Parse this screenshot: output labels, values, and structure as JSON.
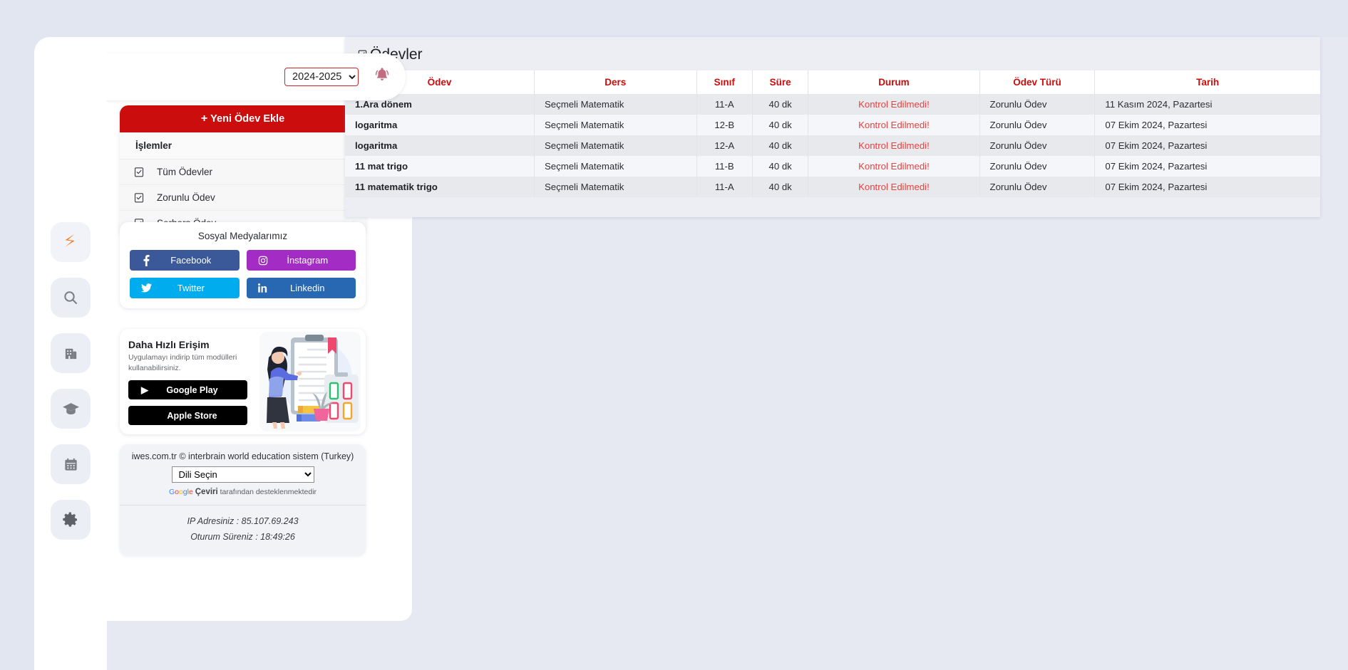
{
  "header": {
    "year_selected": "2024-2025",
    "year_options": [
      "2024-2025"
    ],
    "bell_icon": "bell-icon"
  },
  "icon_rail": [
    {
      "name": "logo-icon",
      "label": "iWES"
    },
    {
      "name": "search-icon",
      "label": "Arama"
    },
    {
      "name": "building-icon",
      "label": "Kurum"
    },
    {
      "name": "graduation-cap-icon",
      "label": "Okul"
    },
    {
      "name": "calendar-icon",
      "label": "Takvim"
    },
    {
      "name": "gear-icon",
      "label": "Ayarlar"
    }
  ],
  "menu": {
    "new_button_label": "Yeni Ödev Ekle",
    "new_button_plus": "+",
    "section_title": "İşlemler",
    "items": [
      {
        "label": "Tüm Ödevler",
        "icon": "clipboard-check-icon",
        "chevron": "›"
      },
      {
        "label": "Zorunlu Ödev",
        "icon": "clipboard-check-icon",
        "chevron": "›"
      },
      {
        "label": "Serbers Ödev",
        "icon": "clipboard-check-icon",
        "chevron": "›"
      }
    ]
  },
  "social": {
    "title": "Sosyal Medyalarımız",
    "buttons": [
      {
        "label": "Facebook",
        "icon": "facebook-icon",
        "glyph": "f",
        "color": "#3b5998"
      },
      {
        "label": "İnstagram",
        "icon": "instagram-icon",
        "glyph": "◙",
        "color": "#a32cc4"
      },
      {
        "label": "Twitter",
        "icon": "twitter-icon",
        "glyph": "🐦",
        "color": "#00acee"
      },
      {
        "label": "Linkedin",
        "icon": "linkedin-icon",
        "glyph": "in",
        "color": "#2867b2"
      }
    ]
  },
  "promo": {
    "title": "Daha Hızlı Erişim",
    "subtitle": "Uygulamayı indirip tüm modülleri kullanabilirsiniz.",
    "google_play_label": "Google Play",
    "apple_store_label": "Apple Store",
    "google_play_icon": "play-triangle-icon",
    "apple_store_icon": "apple-icon",
    "illustration": "woman-with-clipboard-illustration"
  },
  "footer": {
    "copyright": "iwes.com.tr © interbrain world education sistem (Turkey)",
    "language_selected": "Dili Seçin",
    "language_options": [
      "Dili Seçin"
    ],
    "google_translate_prefix": "Google",
    "google_translate_strong": "Çeviri",
    "google_translate_suffix": " tarafından desteklenmektedir",
    "ip_line": "IP Adresiniz : 85.107.69.243",
    "session_line": "Oturum Süreniz : 18:49:26"
  },
  "content": {
    "title": "Ödevler",
    "title_icon": "clipboard-check-icon",
    "columns": [
      "Ödev",
      "Ders",
      "Sınıf",
      "Süre",
      "Durum",
      "Ödev Türü",
      "Tarih"
    ],
    "rows": [
      {
        "odev": "1.Ara dönem",
        "ders": "Seçmeli Matematik",
        "sinif": "11-A",
        "sure": "40 dk",
        "durum": "Kontrol Edilmedi!",
        "tur": "Zorunlu Ödev",
        "tarih": "11 Kasım 2024, Pazartesi"
      },
      {
        "odev": "logaritma",
        "ders": "Seçmeli Matematik",
        "sinif": "12-B",
        "sure": "40 dk",
        "durum": "Kontrol Edilmedi!",
        "tur": "Zorunlu Ödev",
        "tarih": "07 Ekim 2024, Pazartesi"
      },
      {
        "odev": "logaritma",
        "ders": "Seçmeli Matematik",
        "sinif": "12-A",
        "sure": "40 dk",
        "durum": "Kontrol Edilmedi!",
        "tur": "Zorunlu Ödev",
        "tarih": "07 Ekim 2024, Pazartesi"
      },
      {
        "odev": "11 mat trigo",
        "ders": "Seçmeli Matematik",
        "sinif": "11-B",
        "sure": "40 dk",
        "durum": "Kontrol Edilmedi!",
        "tur": "Zorunlu Ödev",
        "tarih": "07 Ekim 2024, Pazartesi"
      },
      {
        "odev": "11 matematik trigo",
        "ders": "Seçmeli Matematik",
        "sinif": "11-A",
        "sure": "40 dk",
        "durum": "Kontrol Edilmedi!",
        "tur": "Zorunlu Ödev",
        "tarih": "07 Ekim 2024, Pazartesi"
      }
    ]
  },
  "colors": {
    "brand_red": "#cc0d0d",
    "status_red": "#e8413f",
    "logo_orange": "#f47b20",
    "page_bg": "#e2e6f1"
  }
}
